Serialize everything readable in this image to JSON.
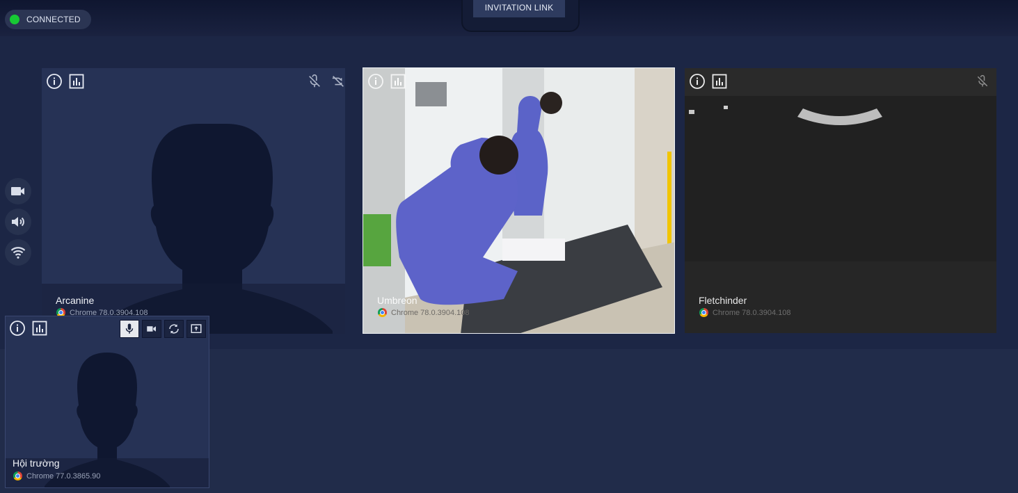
{
  "status": {
    "label": "CONNECTED",
    "color": "#17c934"
  },
  "header": {
    "invite_label": "INVITATION LINK"
  },
  "side_controls": [
    {
      "icon": "camera-icon"
    },
    {
      "icon": "speaker-icon"
    },
    {
      "icon": "wifi-icon"
    }
  ],
  "tiles": [
    {
      "name": "Arcanine",
      "browser": "Chrome 78.0.3904.108"
    },
    {
      "name": "Umbreon",
      "browser": "Chrome 78.0.3904.108"
    },
    {
      "name": "Fletchinder",
      "browser": "Chrome 78.0.3904.108"
    }
  ],
  "self_view": {
    "name": "Hội trường",
    "browser": "Chrome 77.0.3865.90",
    "controls": [
      "microphone-icon",
      "video-camera-icon",
      "switch-camera-icon",
      "share-screen-icon"
    ]
  }
}
